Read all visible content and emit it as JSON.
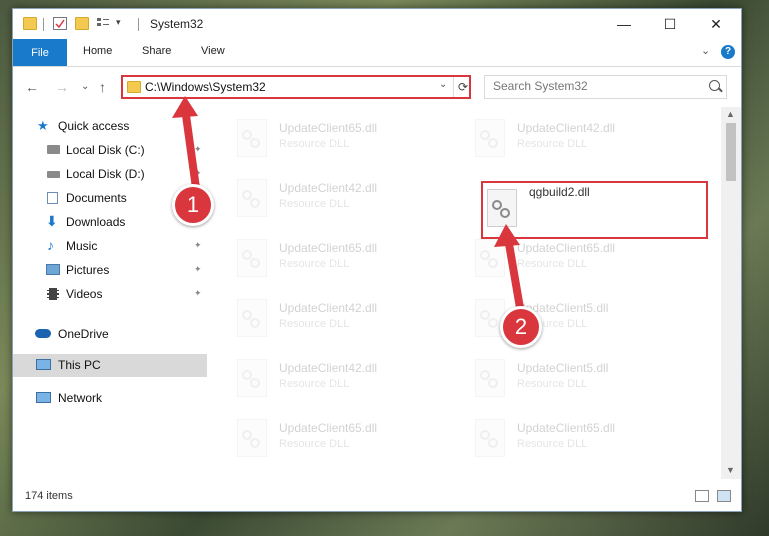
{
  "window": {
    "title": "System32",
    "minimize": "—",
    "maximize": "☐",
    "close": "✕"
  },
  "ribbon": {
    "tabs": [
      "File",
      "Home",
      "Share",
      "View"
    ],
    "expand_glyph": "⌄",
    "help_glyph": "?"
  },
  "toolbar": {
    "back": "←",
    "forward": "→",
    "recent": "⌄",
    "up": "↑"
  },
  "address": {
    "path": "C:\\Windows\\System32",
    "dropdown": "⌄",
    "refresh": "⟳"
  },
  "search": {
    "placeholder": "Search System32"
  },
  "sidebar": {
    "items": [
      {
        "label": "Quick access",
        "icon": "star-icon"
      },
      {
        "label": "Local Disk (C:)",
        "icon": "drive-icon"
      },
      {
        "label": "Local Disk (D:)",
        "icon": "drive-icon"
      },
      {
        "label": "Documents",
        "icon": "documents-icon"
      },
      {
        "label": "Downloads",
        "icon": "download-icon"
      },
      {
        "label": "Music",
        "icon": "music-icon"
      },
      {
        "label": "Pictures",
        "icon": "pictures-icon"
      },
      {
        "label": "Videos",
        "icon": "videos-icon"
      },
      {
        "label": "OneDrive",
        "icon": "cloud-icon"
      },
      {
        "label": "This PC",
        "icon": "computer-icon"
      },
      {
        "label": "Network",
        "icon": "network-icon"
      }
    ],
    "pin_glyph": "📌"
  },
  "files": {
    "left": [
      {
        "name": "UpdateClient65.dll",
        "type": "Resource DLL"
      },
      {
        "name": "UpdateClient42.dll",
        "type": "Resource DLL"
      },
      {
        "name": "UpdateClient65.dll",
        "type": "Resource DLL"
      },
      {
        "name": "UpdateClient42.dll",
        "type": "Resource DLL"
      },
      {
        "name": "UpdateClient42.dll",
        "type": "Resource DLL"
      },
      {
        "name": "UpdateClient65.dll",
        "type": "Resource DLL"
      }
    ],
    "right": [
      {
        "name": "UpdateClient42.dll",
        "type": "Resource DLL"
      },
      {
        "name": "qgbuild2.dll",
        "type": ""
      },
      {
        "name": "UpdateClient65.dll",
        "type": "Resource DLL"
      },
      {
        "name": "UpdateClient5.dll",
        "type": "Resource DLL"
      },
      {
        "name": "UpdateClient5.dll",
        "type": "Resource DLL"
      },
      {
        "name": "UpdateClient65.dll",
        "type": "Resource DLL"
      }
    ]
  },
  "status": {
    "count": "174 items"
  },
  "annotations": {
    "badge_1": "1",
    "badge_2": "2",
    "color": "#d9363e"
  }
}
